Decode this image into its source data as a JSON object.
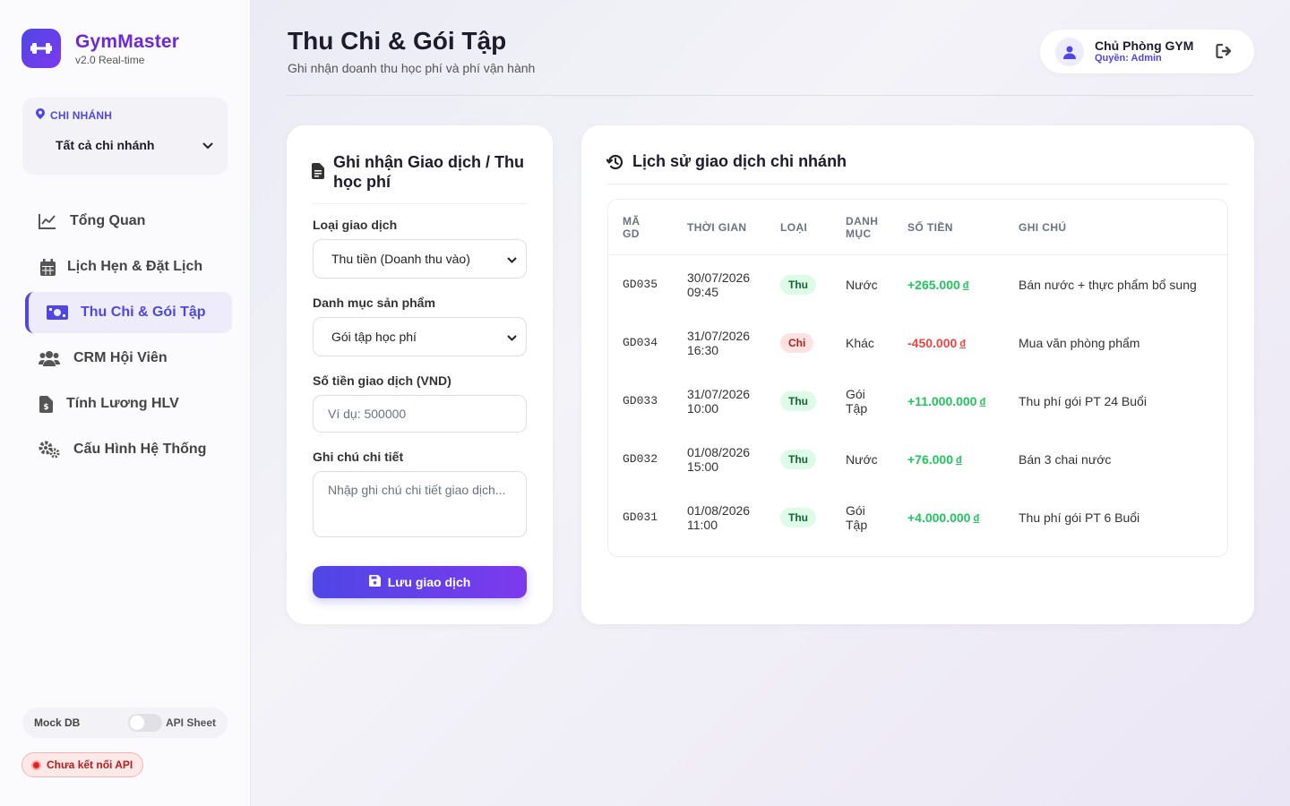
{
  "brand": {
    "name": "GymMaster",
    "version": "v2.0 Real-time"
  },
  "branch": {
    "label": "CHI NHÁNH",
    "selected": "Tất cả chi nhánh"
  },
  "nav": [
    {
      "label": "Tổng Quan",
      "icon": "chart-line-icon",
      "active": false
    },
    {
      "label": "Lịch Hẹn & Đặt Lịch",
      "icon": "calendar-icon",
      "active": false
    },
    {
      "label": "Thu Chi & Gói Tập",
      "icon": "money-bill-icon",
      "active": true
    },
    {
      "label": "CRM Hội Viên",
      "icon": "users-icon",
      "active": false
    },
    {
      "label": "Tính Lương HLV",
      "icon": "invoice-icon",
      "active": false
    },
    {
      "label": "Cấu Hình Hệ Thống",
      "icon": "gears-icon",
      "active": false
    }
  ],
  "mode": {
    "left": "Mock DB",
    "right": "API Sheet"
  },
  "api_status": "Chưa kết nối API",
  "header": {
    "title": "Thu Chi & Gói Tập",
    "subtitle": "Ghi nhận doanh thu học phí và phí vận hành"
  },
  "user": {
    "name": "Chủ Phòng GYM",
    "role": "Quyền: Admin"
  },
  "form": {
    "title": "Ghi nhận Giao dịch / Thu học phí",
    "type_label": "Loại giao dịch",
    "type_value": "Thu tiền (Doanh thu vào)",
    "category_label": "Danh mục sản phẩm",
    "category_value": "Gói tập học phí",
    "amount_label": "Số tiền giao dịch (VND)",
    "amount_placeholder": "Ví dụ: 500000",
    "note_label": "Ghi chú chi tiết",
    "note_placeholder": "Nhập ghi chú chi tiết giao dịch...",
    "save_label": "Lưu giao dịch"
  },
  "history": {
    "title": "Lịch sử giao dịch chi nhánh",
    "columns": {
      "id_1": "MÃ",
      "id_2": "GD",
      "time": "THỜI GIAN",
      "type": "LOẠI",
      "cat_1": "DANH",
      "cat_2": "MỤC",
      "amount": "SỐ TIỀN",
      "note": "GHI CHÚ"
    },
    "currency": "đ",
    "rows": [
      {
        "id": "GD035",
        "date": "30/07/2026",
        "time": "09:45",
        "type": "Thu",
        "cat_1": "Nước",
        "cat_2": "",
        "amount": "+265.000",
        "note": "Bán nước + thực phẩm bổ sung"
      },
      {
        "id": "GD034",
        "date": "31/07/2026",
        "time": "16:30",
        "type": "Chi",
        "cat_1": "Khác",
        "cat_2": "",
        "amount": "-450.000",
        "note": "Mua văn phòng phẩm"
      },
      {
        "id": "GD033",
        "date": "31/07/2026",
        "time": "10:00",
        "type": "Thu",
        "cat_1": "Gói",
        "cat_2": "Tập",
        "amount": "+11.000.000",
        "note": "Thu phí gói PT 24 Buổi"
      },
      {
        "id": "GD032",
        "date": "01/08/2026",
        "time": "15:00",
        "type": "Thu",
        "cat_1": "Nước",
        "cat_2": "",
        "amount": "+76.000",
        "note": "Bán 3 chai nước"
      },
      {
        "id": "GD031",
        "date": "01/08/2026",
        "time": "11:00",
        "type": "Thu",
        "cat_1": "Gói",
        "cat_2": "Tập",
        "amount": "+4.000.000",
        "note": "Thu phí gói PT 6 Buổi"
      }
    ]
  },
  "colors": {
    "accent": "#4f46e5",
    "accent_2": "#7c3aed",
    "income": "#22c55e",
    "expense": "#ef4444"
  }
}
